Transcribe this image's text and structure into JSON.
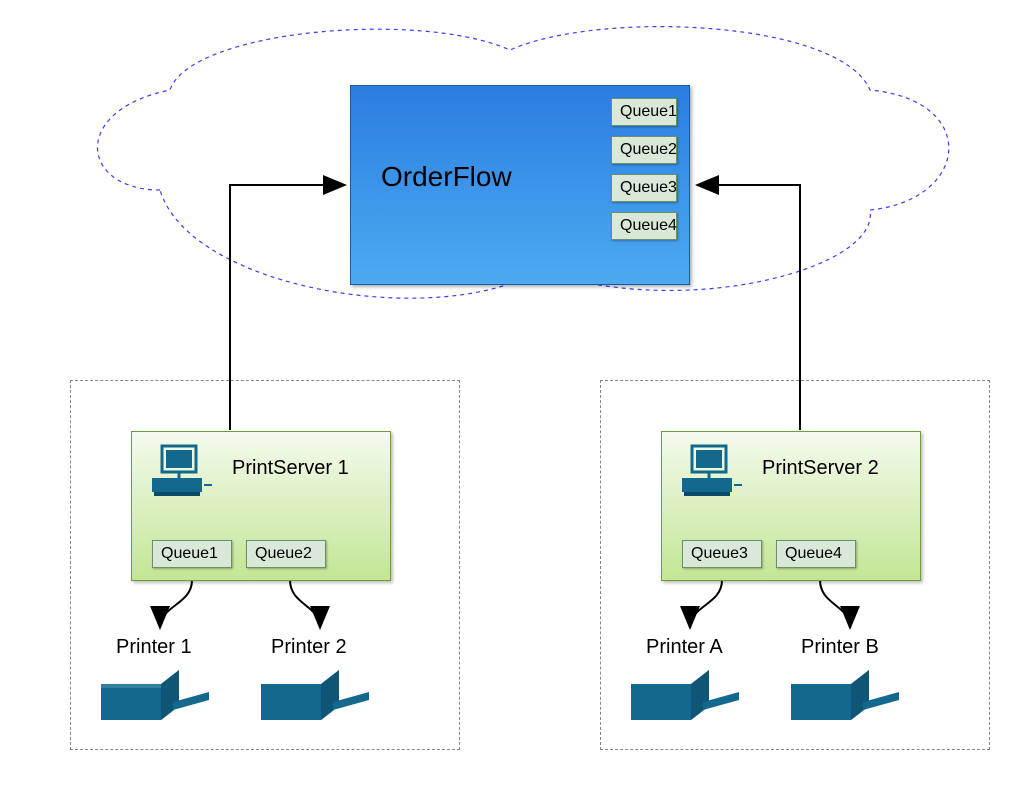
{
  "orderflow": {
    "title": "OrderFlow",
    "queues": [
      "Queue1",
      "Queue2",
      "Queue3",
      "Queue4"
    ]
  },
  "printServers": [
    {
      "title": "PrintServer 1",
      "queues": [
        "Queue1",
        "Queue2"
      ],
      "printers": [
        "Printer 1",
        "Printer 2"
      ]
    },
    {
      "title": "PrintServer 2",
      "queues": [
        "Queue3",
        "Queue4"
      ],
      "printers": [
        "Printer A",
        "Printer B"
      ]
    }
  ],
  "colors": {
    "cloudStroke": "#3b3cff",
    "orderflowTop": "#2a7ee0",
    "orderflowBottom": "#4caaf1",
    "queueBg": "#d9e8d9",
    "serverBgTop": "#f4faee",
    "serverBgBottom": "#c3e694",
    "printerColor": "#13688e"
  }
}
